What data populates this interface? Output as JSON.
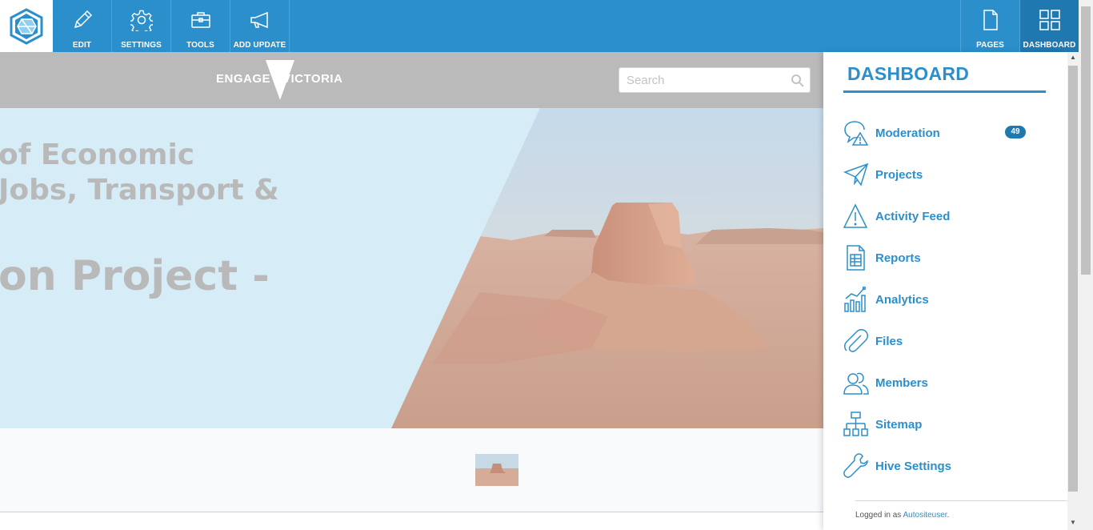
{
  "toolbar": {
    "items": [
      {
        "label": "EDIT",
        "icon": "pencil-icon"
      },
      {
        "label": "SETTINGS",
        "icon": "gear-icon"
      },
      {
        "label": "TOOLS",
        "icon": "briefcase-icon"
      },
      {
        "label": "ADD UPDATE",
        "icon": "megaphone-icon"
      }
    ],
    "right_items": [
      {
        "label": "PAGES",
        "icon": "page-icon"
      },
      {
        "label": "DASHBOARD",
        "icon": "grid-icon",
        "active": true
      }
    ],
    "accent": "#2b8fcc"
  },
  "site": {
    "logo_left": "ENGAGE",
    "logo_right": "VICTORIA",
    "search_placeholder": "Search"
  },
  "hero": {
    "line1": "of Economic",
    "line2": "Jobs, Transport &",
    "line3": "on Project -"
  },
  "dashboard": {
    "title": "DASHBOARD",
    "items": [
      {
        "label": "Moderation",
        "icon": "moderation-icon",
        "badge": "49"
      },
      {
        "label": "Projects",
        "icon": "paper-plane-icon"
      },
      {
        "label": "Activity Feed",
        "icon": "warning-icon"
      },
      {
        "label": "Reports",
        "icon": "report-icon"
      },
      {
        "label": "Analytics",
        "icon": "chart-icon"
      },
      {
        "label": "Files",
        "icon": "paperclip-icon"
      },
      {
        "label": "Members",
        "icon": "members-icon"
      },
      {
        "label": "Sitemap",
        "icon": "sitemap-icon"
      },
      {
        "label": "Hive Settings",
        "icon": "wrench-icon"
      }
    ],
    "footer_prefix": "Logged in as",
    "footer_user": "Autositeuser",
    "footer_suffix": "."
  }
}
